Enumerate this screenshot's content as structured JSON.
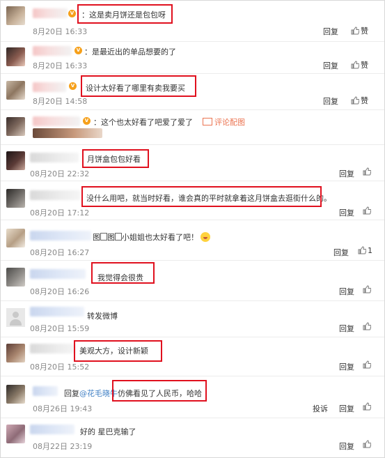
{
  "ui": {
    "reply_label": "回复",
    "like_label": "赞",
    "report_label": "投诉",
    "pic_link_label": "评论配图",
    "reply_prefix": "回复"
  },
  "comments": [
    {
      "text": "：这是卖月饼还是包包呀",
      "time": "8月20日 16:33"
    },
    {
      "text": "：是最近出的单品想要的了",
      "time": "8月20日 16:33"
    },
    {
      "text": "设计太好看了哪里有卖我要买",
      "time": "8月20日 14:58"
    },
    {
      "text": "：这个也太好看了吧爱了爱了"
    },
    {
      "text": "月饼盒包包好看",
      "time": "08月20日 22:32"
    },
    {
      "text": "没什么用吧，就当时好看，谁会真的平时就拿着这月饼盒去逛街什么的。",
      "time": "08月20日 17:12"
    },
    {
      "text": "小姐姐也太好看了吧！",
      "pic1": "图",
      "pic2": "图",
      "time": "08月20日 16:27",
      "likes": "1"
    },
    {
      "text": "我觉得会很贵",
      "time": "08月20日 16:26"
    },
    {
      "text": "转发微博",
      "time": "08月20日 15:59"
    },
    {
      "text": "美观大方，设计新颖",
      "time": "08月20日 15:52"
    },
    {
      "mention": "@花毛晓牛",
      "text": "仿佛看见了人民币，哈哈",
      "time": "08月26日 19:43"
    },
    {
      "text": "好的 星巴克输了",
      "time": "08月22日 23:19"
    }
  ]
}
